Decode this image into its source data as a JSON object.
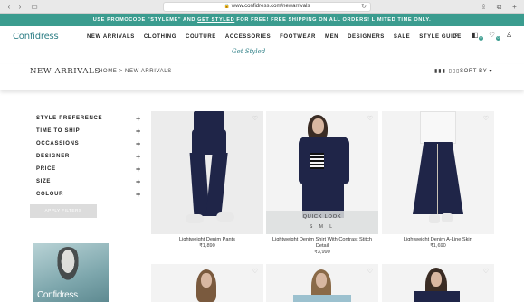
{
  "browser": {
    "url": "www.confidress.com/newarrivals"
  },
  "promo_banner": {
    "prefix": "USE PROMOCODE \"STYLEME\" AND ",
    "link": "GET STYLED",
    "suffix": " FOR FREE! FREE SHIPPING ON ALL ORDERS! LIMITED TIME ONLY."
  },
  "header": {
    "logo": "Confidress",
    "tagline": "Get Styled",
    "nav": [
      "NEW ARRIVALS",
      "CLOTHING",
      "COUTURE",
      "ACCESSORIES",
      "FOOTWEAR",
      "MEN",
      "DESIGNERS",
      "SALE",
      "STYLE GUIDE"
    ],
    "icons": [
      {
        "name": "search-icon",
        "glyph": "⌕",
        "badge": ""
      },
      {
        "name": "bag-icon",
        "glyph": "◧",
        "badge": "0"
      },
      {
        "name": "wishlist-icon",
        "glyph": "♡",
        "badge": "0"
      },
      {
        "name": "user-icon",
        "glyph": "♙",
        "badge": ""
      }
    ]
  },
  "subheader": {
    "title": "NEW ARRIVALS",
    "breadcrumb": "HOME  >  NEW ARRIVALS",
    "sort_label": "SORT BY"
  },
  "filters": {
    "items": [
      "STYLE PREFERENCE",
      "TIME TO SHIP",
      "OCCASSIONS",
      "DESIGNER",
      "PRICE",
      "SIZE",
      "COLOUR"
    ],
    "apply_label": "APPLY FILTERS"
  },
  "promo_tile": {
    "text": "Confidress"
  },
  "products": [
    {
      "name": "Lightweight Denim Pants",
      "price": "₹1,890"
    },
    {
      "name": "Lightweight Denim Shirt With Contrast Stitch Detail",
      "price": "₹3,990",
      "quick_look": "QUICK LOOK",
      "sizes": "S M L"
    },
    {
      "name": "Lightweight Denim A-Line Skirt",
      "price": "₹1,690"
    }
  ],
  "colors": {
    "accent": "#3b9c8f",
    "logo": "#2e7f86",
    "denim": "#1f2548"
  }
}
